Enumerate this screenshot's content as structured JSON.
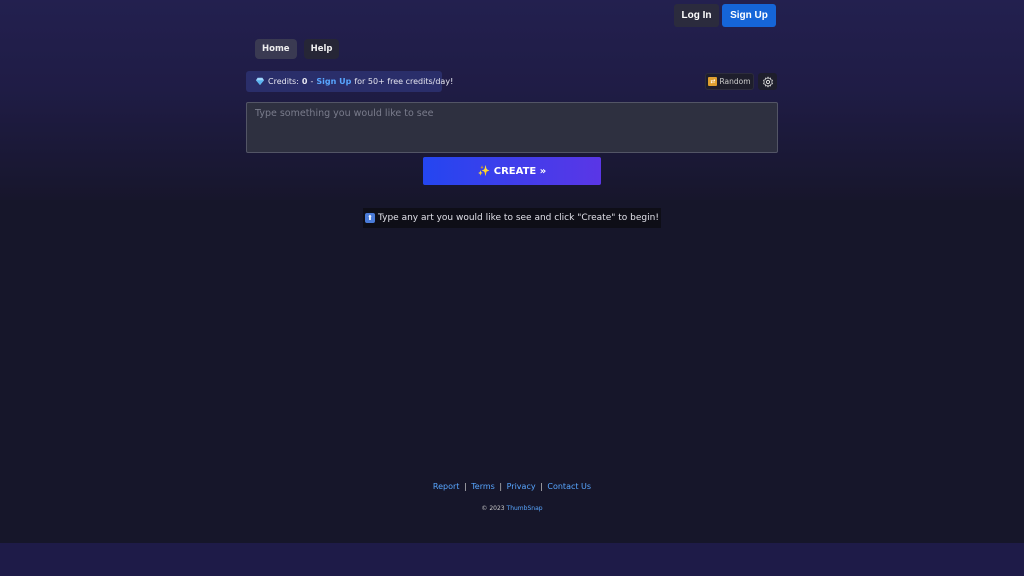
{
  "header": {
    "login_label": "Log In",
    "signup_label": "Sign Up"
  },
  "nav": {
    "home_label": "Home",
    "help_label": "Help"
  },
  "credits": {
    "prefix": "Credits:",
    "count": "0",
    "dash": "-",
    "signup_link": "Sign Up",
    "suffix": "for 50+ free credits/day!",
    "icon": "gem-icon"
  },
  "toolbar": {
    "random_label": "Random",
    "random_icon": "shuffle-icon",
    "settings_icon": "gear-icon"
  },
  "prompt": {
    "placeholder": "Type something you would like to see",
    "value": ""
  },
  "create_button": {
    "label": "✨ CREATE »"
  },
  "hint": {
    "icon": "up-arrow-icon",
    "text": "Type any art you would like to see and click \"Create\" to begin!"
  },
  "footer": {
    "links": [
      "Report",
      "Terms",
      "Privacy",
      "Contact Us"
    ],
    "separator": "|",
    "copyright_prefix": "© 2023",
    "brand": "ThumbSnap"
  },
  "colors": {
    "accent_blue": "#1565d8",
    "link_blue": "#58a6ff",
    "create_gradient_start": "#2446f0",
    "create_gradient_end": "#5a36e6",
    "background": "#16162a"
  }
}
